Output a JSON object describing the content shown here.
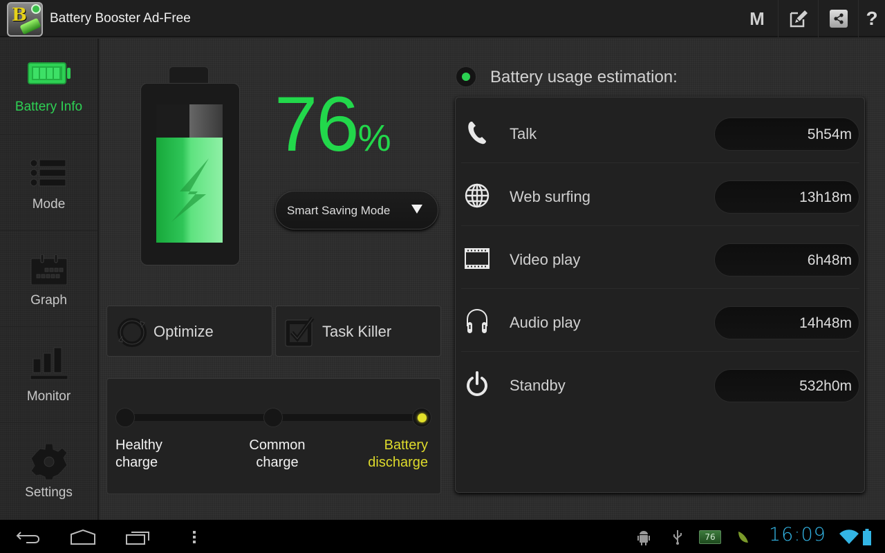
{
  "app": {
    "title": "Battery Booster Ad-Free",
    "icon_letter": "B"
  },
  "actionbar": {
    "m_label": "M",
    "edit_icon": "edit-icon",
    "share_icon": "share-icon",
    "help_label": "?"
  },
  "sidebar": {
    "items": [
      {
        "label": "Battery Info",
        "icon": "battery-icon",
        "active": true
      },
      {
        "label": "Mode",
        "icon": "list-icon",
        "active": false
      },
      {
        "label": "Graph",
        "icon": "calendar-icon",
        "active": false
      },
      {
        "label": "Monitor",
        "icon": "bar-chart-icon",
        "active": false
      },
      {
        "label": "Settings",
        "icon": "gear-icon",
        "active": false
      }
    ]
  },
  "battery": {
    "level_percent": 76,
    "level_text": "76",
    "percent_sign": "%",
    "charging": true,
    "mode": "Smart Saving Mode"
  },
  "buttons": {
    "optimize": "Optimize",
    "task_killer": "Task Killer"
  },
  "charge_state": {
    "stages": [
      {
        "line1": "Healthy",
        "line2": "charge",
        "active": false
      },
      {
        "line1": "Common",
        "line2": "charge",
        "active": false
      },
      {
        "line1": "Battery",
        "line2": "discharge",
        "active": true
      }
    ],
    "active_color": "#dedb2c"
  },
  "estimation": {
    "title": "Battery usage estimation:",
    "rows": [
      {
        "name": "Talk",
        "value": "5h54m",
        "icon": "phone-icon"
      },
      {
        "name": "Web surfing",
        "value": "13h18m",
        "icon": "globe-icon"
      },
      {
        "name": "Video play",
        "value": "6h48m",
        "icon": "film-icon"
      },
      {
        "name": "Audio play",
        "value": "14h48m",
        "icon": "headphones-icon"
      },
      {
        "name": "Standby",
        "value": "532h0m",
        "icon": "power-icon"
      }
    ]
  },
  "statusbar": {
    "time": "16:09",
    "battery_notification": "76",
    "accent": "#33b5e5"
  },
  "colors": {
    "accent_green": "#22d84b",
    "warning_yellow": "#dedb2c"
  }
}
